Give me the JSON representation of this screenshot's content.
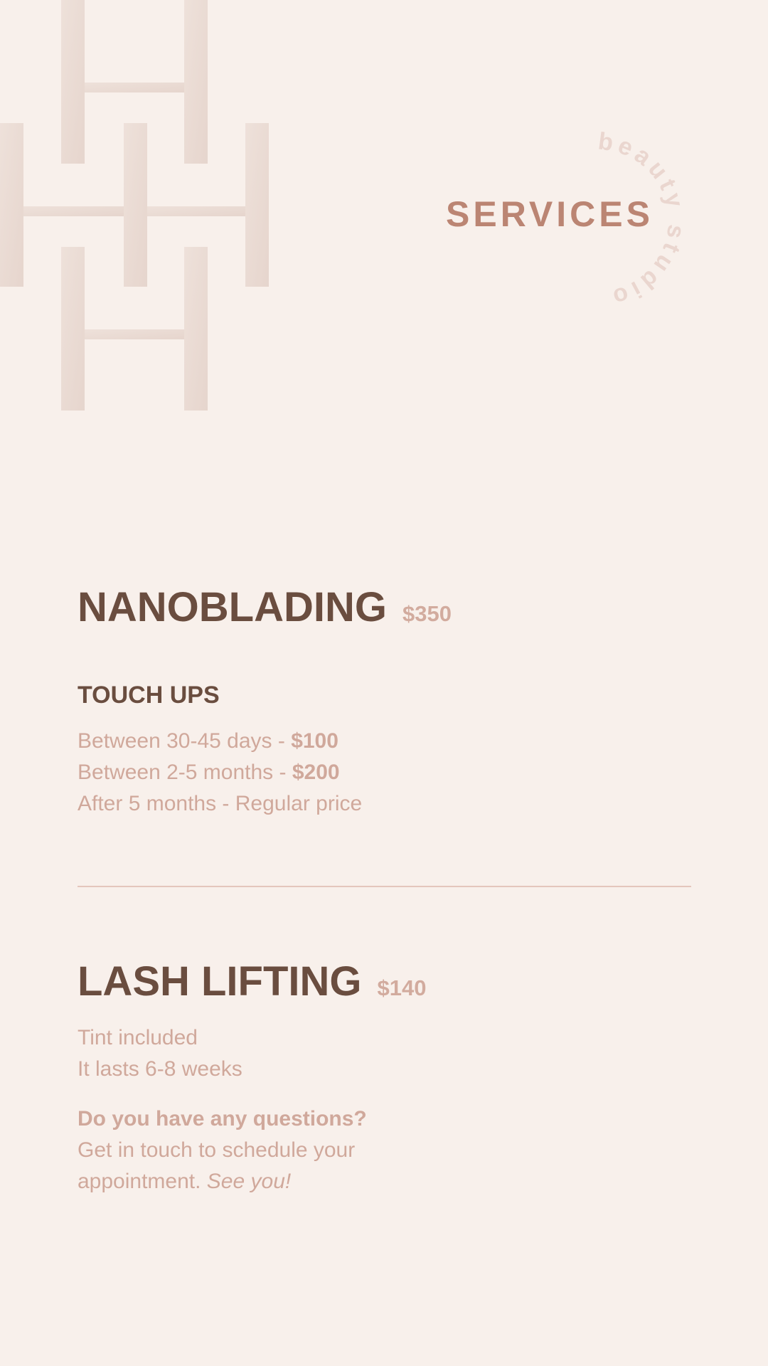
{
  "header": {
    "title": "SERVICES",
    "circle_text": "beauty studio"
  },
  "services": [
    {
      "name": "NANOBLADING",
      "price": "$350",
      "subheading": "TOUCH UPS",
      "lines": [
        {
          "text": "Between 30-45 days - ",
          "bold": "$100"
        },
        {
          "text": "Between 2-5 months - ",
          "bold": "$200"
        },
        {
          "text": "After 5 months - Regular price",
          "bold": ""
        }
      ]
    },
    {
      "name": "LASH LIFTING",
      "price": "$140",
      "lines": [
        {
          "text": "Tint included"
        },
        {
          "text": "It lasts 6-8 weeks"
        }
      ]
    }
  ],
  "contact": {
    "question": "Do you have any questions?",
    "line1": "Get in touch to schedule your",
    "line2": "appointment. ",
    "line2_italic": "See you!"
  },
  "colors": {
    "background": "#f8f0eb",
    "heading": "#6a4d3f",
    "accent": "#bb8573",
    "muted": "#d0a89b",
    "logo": "#e9dbd4"
  }
}
